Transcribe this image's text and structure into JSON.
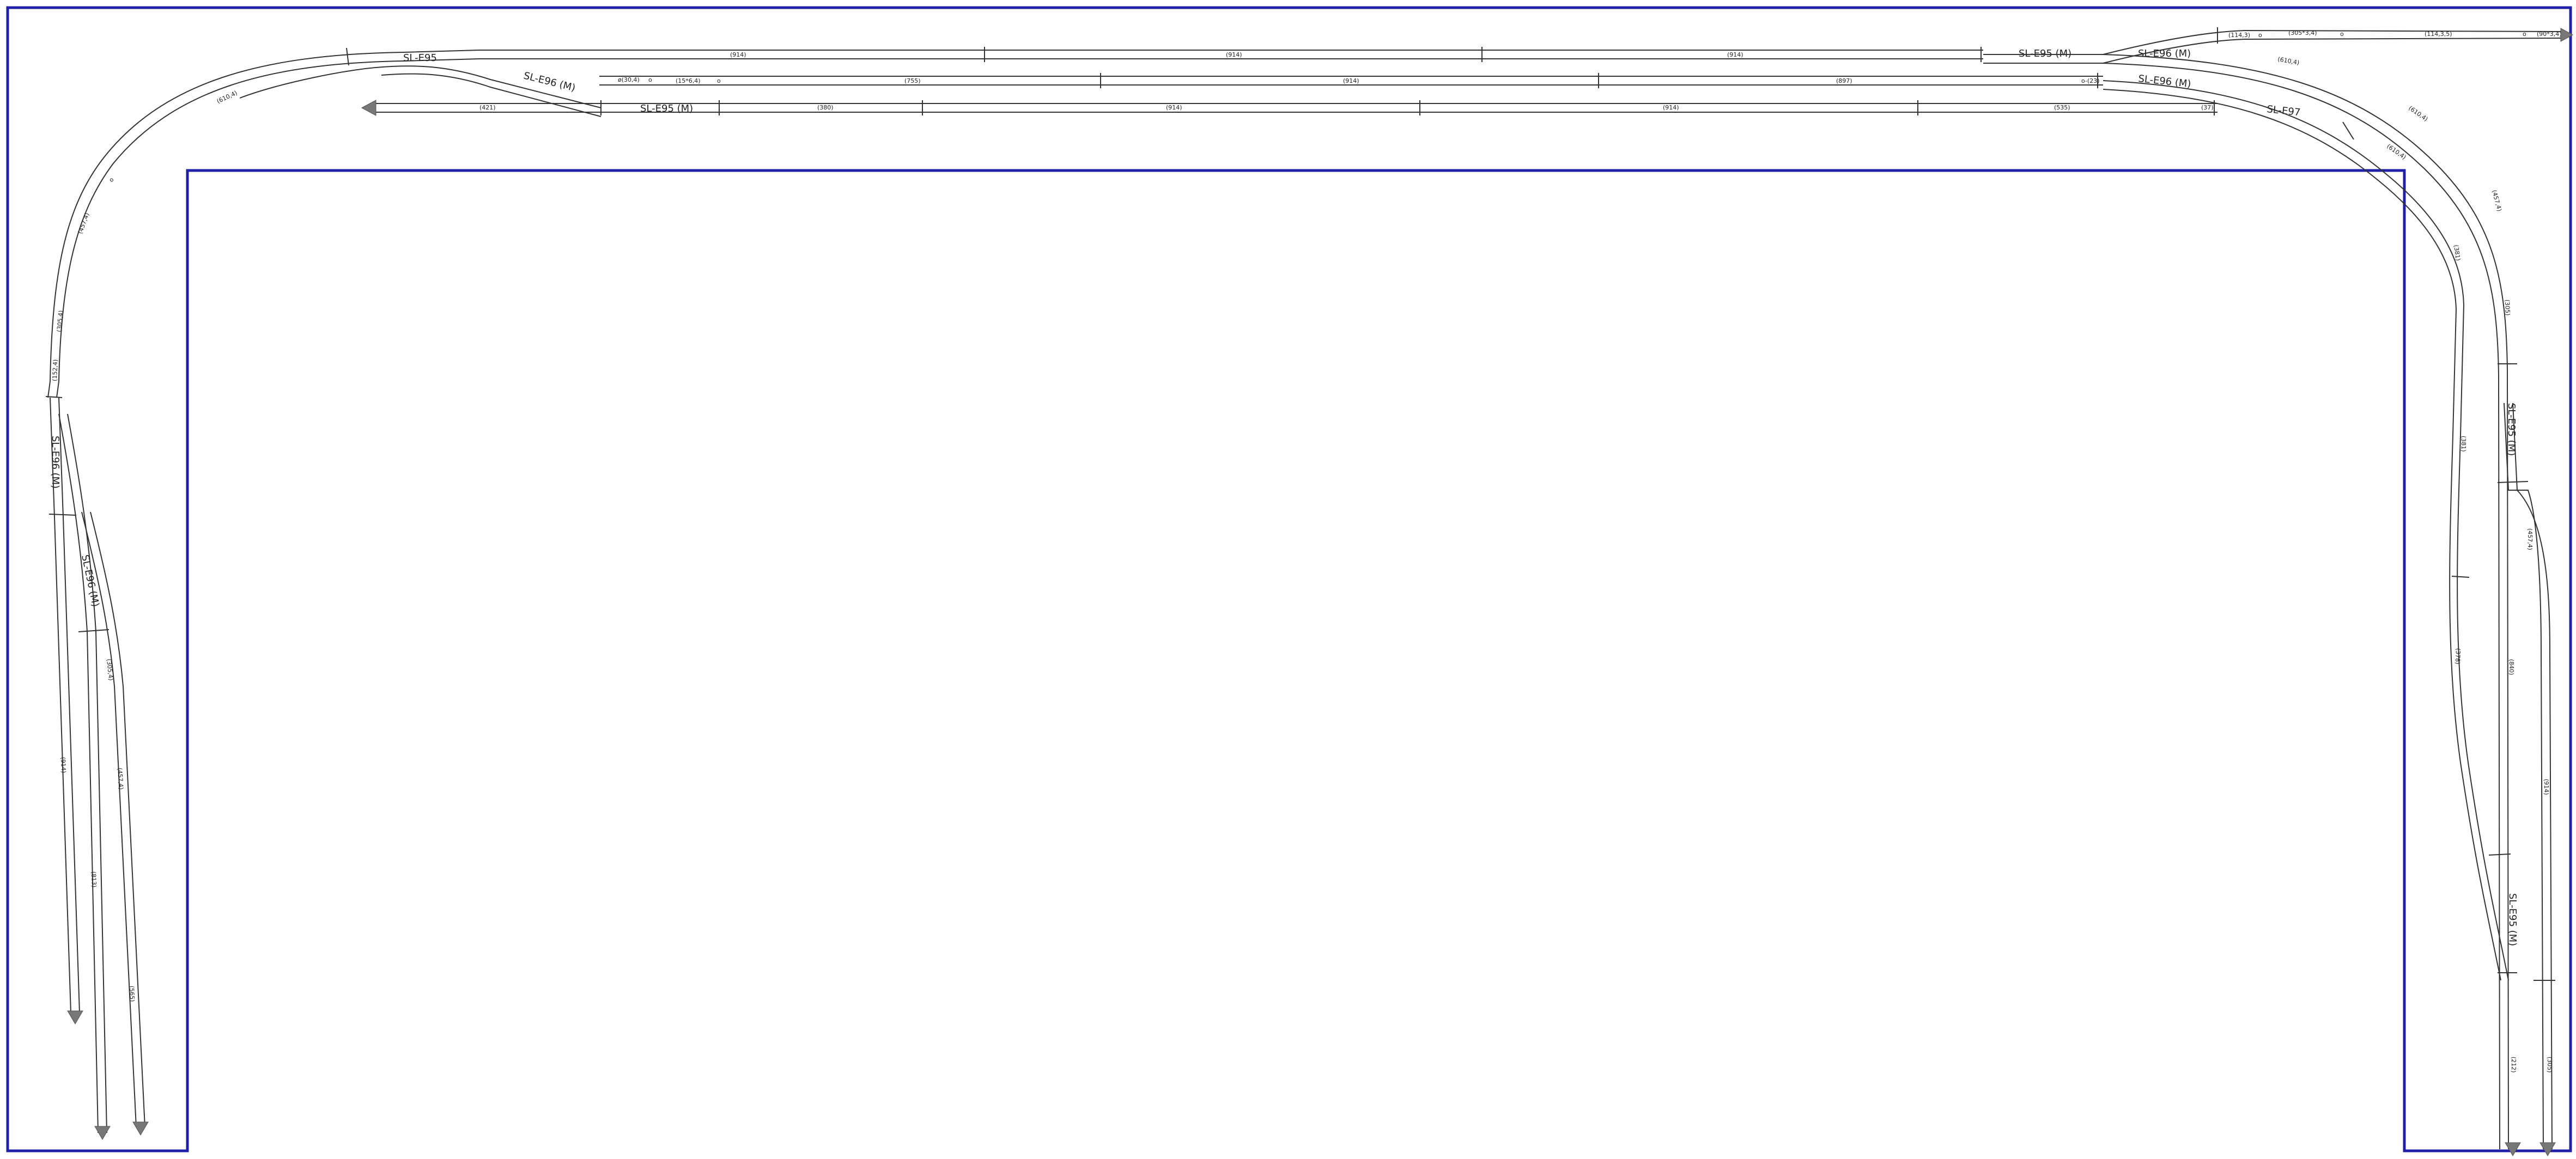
{
  "colors": {
    "board_outline": "#1f1fa8",
    "track": "#333333",
    "end_arrow": "#777777"
  },
  "top_tracks": {
    "row1": [
      "(914)",
      "(914)",
      "(914)",
      "(914)"
    ],
    "row2": [
      "ø(30,4)",
      "o",
      "(15*6,4)",
      "o",
      "(755)",
      "(914)",
      "(897)",
      "o-(23)"
    ],
    "row3": [
      "(421)",
      "(380)",
      "(914)",
      "(914)",
      "(535)",
      "(37)"
    ],
    "far_right": [
      "(114,3)",
      "o",
      "(305*3,4)",
      "o",
      "(114,3,5)",
      "o",
      "(90*3,4)"
    ]
  },
  "turnouts": {
    "top_left": "SL-E95",
    "mid_left": "SL-E96 (M)",
    "bottom_left": "SL-E95 (M)",
    "top_right": "SL-E95 (M)",
    "top_right_2": "SL-E96 (M)",
    "right_mid": "SL-E96 (M)",
    "right_low": "SL-E97",
    "left_vertical": "SL-E96 (M)",
    "left_lower": "SL-E96 (M)",
    "right_vertical_1": "SL-E95 (M)",
    "right_vertical_2": "SL-E95 (M)"
  },
  "curve_labels": {
    "left_outer": [
      "(610,4)",
      "o",
      "(610,4)",
      "o",
      "(457,4)",
      "o",
      "(305,4)",
      "o",
      "(152,4)"
    ],
    "right_outer": [
      "(610,4)",
      "o",
      "(610,4)",
      "o",
      "(457,4)",
      "(305)"
    ],
    "right_inner": [
      "(610,4)",
      "(381)",
      "(381)",
      "o",
      "(378)"
    ],
    "left_branches": [
      "(305,4)",
      "(914)",
      "(813)",
      "(457,4)",
      "(565)"
    ],
    "right_verticals": [
      "(457,4)",
      "(840)",
      "(914)",
      "(914)",
      "(212)",
      "(305)"
    ]
  }
}
